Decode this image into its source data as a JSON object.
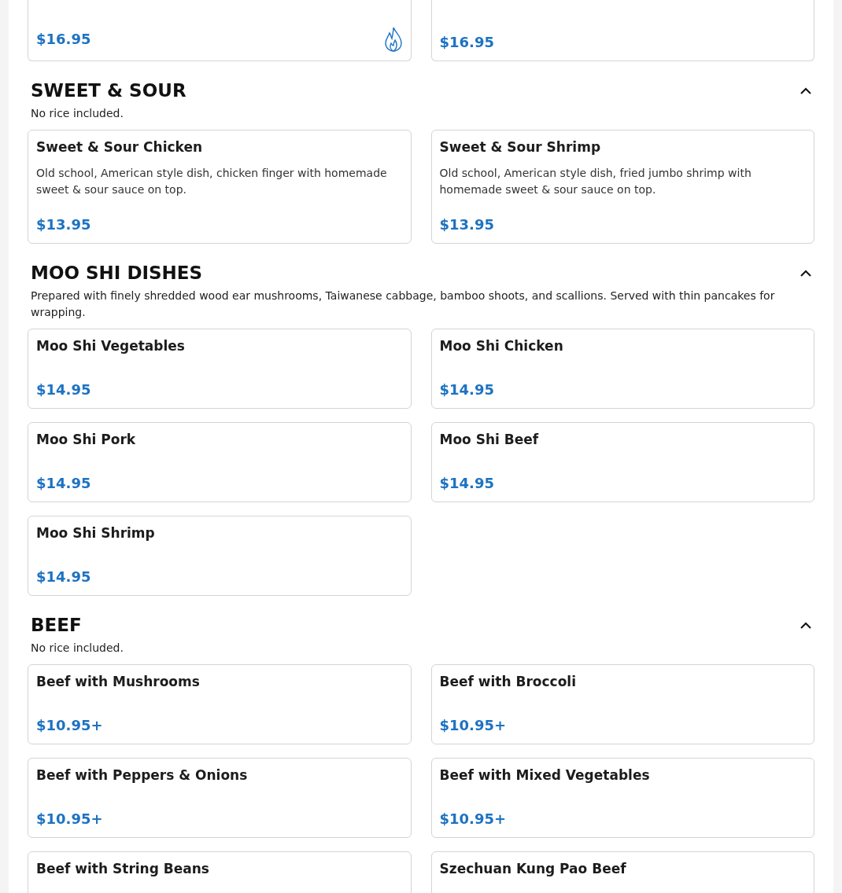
{
  "top_items": [
    {
      "price": "$16.95",
      "spicy": true
    },
    {
      "price": "$16.95",
      "spicy": false
    }
  ],
  "sections": [
    {
      "title": "SWEET & SOUR",
      "note": "No rice included.",
      "expanded": true,
      "items": [
        {
          "name": "Sweet & Sour Chicken",
          "description": "Old school, American style dish, chicken finger with homemade sweet & sour sauce on top.",
          "price": "$13.95",
          "spicy": false
        },
        {
          "name": "Sweet & Sour Shrimp",
          "description": "Old school, American style dish, fried jumbo shrimp with homemade sweet & sour sauce on top.",
          "price": "$13.95",
          "spicy": false
        }
      ]
    },
    {
      "title": "MOO SHI DISHES",
      "note": "Prepared with finely shredded wood ear mushrooms, Taiwanese cabbage, bamboo shoots, and scallions. Served with thin pancakes for wrapping.",
      "expanded": true,
      "items": [
        {
          "name": "Moo Shi Vegetables",
          "price": "$14.95",
          "spicy": false
        },
        {
          "name": "Moo Shi Chicken",
          "price": "$14.95",
          "spicy": false
        },
        {
          "name": "Moo Shi Pork",
          "price": "$14.95",
          "spicy": false
        },
        {
          "name": "Moo Shi Beef",
          "price": "$14.95",
          "spicy": false
        },
        {
          "name": "Moo Shi Shrimp",
          "price": "$14.95",
          "spicy": false
        }
      ]
    },
    {
      "title": "BEEF",
      "note": "No rice included.",
      "expanded": true,
      "items": [
        {
          "name": "Beef with Mushrooms",
          "price": "$10.95+",
          "spicy": false
        },
        {
          "name": "Beef with Broccoli",
          "price": "$10.95+",
          "spicy": false
        },
        {
          "name": "Beef with Peppers & Onions",
          "price": "$10.95+",
          "spicy": false
        },
        {
          "name": "Beef with Mixed Vegetables",
          "price": "$10.95+",
          "spicy": false
        },
        {
          "name": "Beef with String Beans",
          "spicy": false
        },
        {
          "name": "Szechuan Kung Pao Beef",
          "spicy": false
        }
      ]
    }
  ]
}
